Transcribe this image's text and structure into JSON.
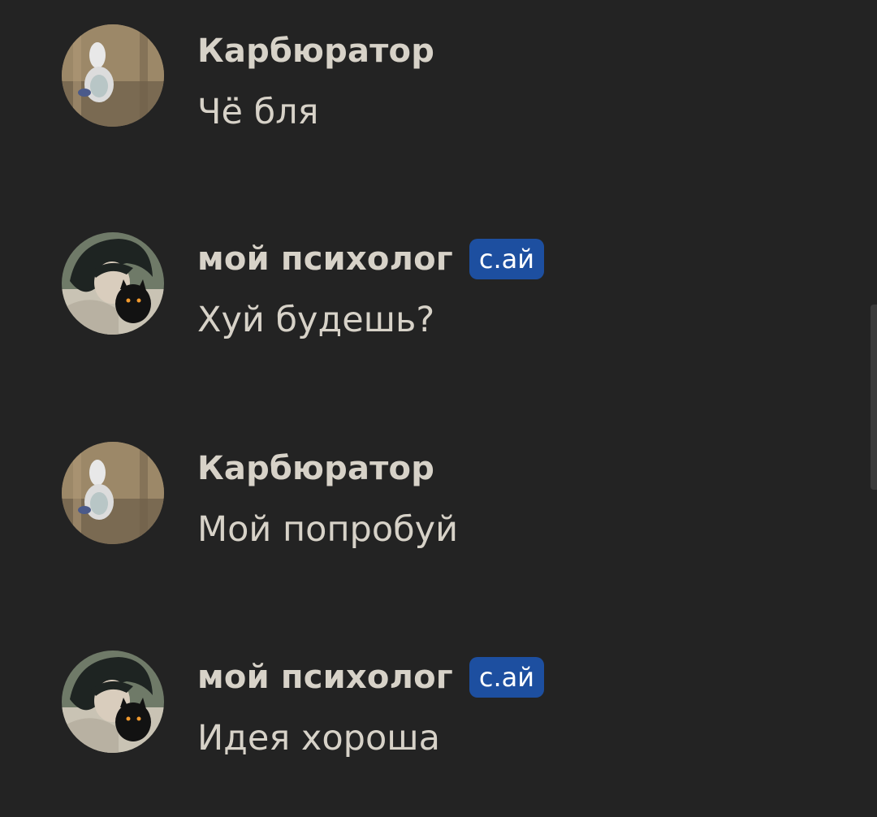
{
  "messages": [
    {
      "author": "Карбюратор",
      "text": "Чё бля",
      "badge": "",
      "avatar": "toilet-avatar"
    },
    {
      "author": "мой психолог",
      "text": "Хуй будешь?",
      "badge": "с.ай",
      "avatar": "anime-cat-avatar"
    },
    {
      "author": "Карбюратор",
      "text": "Мой попробуй",
      "badge": "",
      "avatar": "toilet-avatar"
    },
    {
      "author": "мой психолог",
      "text": "Идея хороша",
      "badge": "с.ай",
      "avatar": "anime-cat-avatar"
    }
  ],
  "colors": {
    "background": "#232323",
    "text": "#d7d2c8",
    "badge": "#1d4fa0"
  }
}
